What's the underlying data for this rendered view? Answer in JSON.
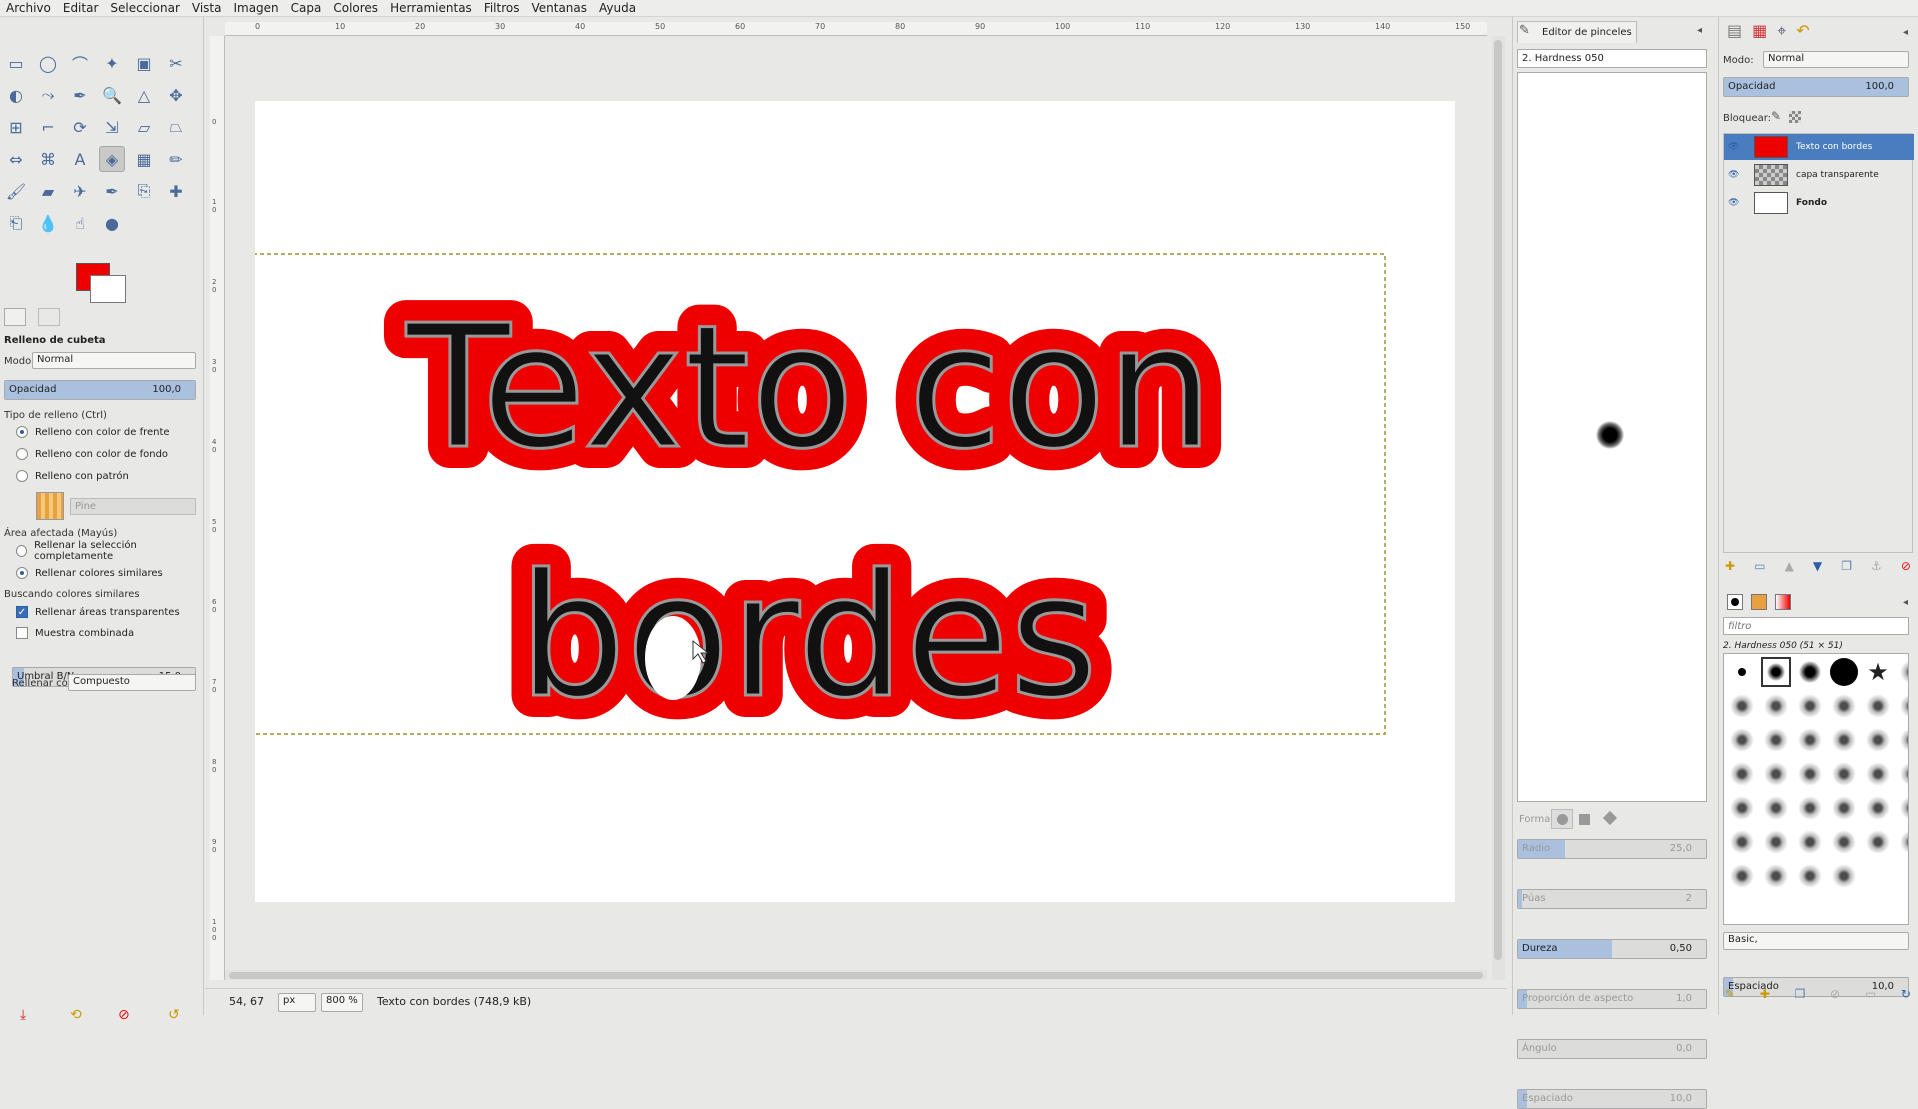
{
  "menu": [
    "Archivo",
    "Editar",
    "Seleccionar",
    "Vista",
    "Imagen",
    "Capa",
    "Colores",
    "Herramientas",
    "Filtros",
    "Ventanas",
    "Ayuda"
  ],
  "ruler_top": [
    "0",
    "10",
    "20",
    "30",
    "40",
    "50",
    "60",
    "70",
    "80",
    "90",
    "100",
    "110",
    "120",
    "130",
    "140",
    "150"
  ],
  "ruler_left": [
    "0",
    "1\n0",
    "2\n0",
    "3\n0",
    "4\n0",
    "5\n0",
    "6\n0",
    "7\n0",
    "8\n0",
    "9\n0",
    "1\n0\n0"
  ],
  "tool_options": {
    "title": "Relleno de cubeta",
    "mode_label": "Modo:",
    "mode_value": "Normal",
    "opacity_label": "Opacidad",
    "opacity_value": "100,0",
    "fill_type_label": "Tipo de relleno  (Ctrl)",
    "fill_fg": "Relleno con color de frente",
    "fill_bg": "Relleno con color de fondo",
    "fill_pattern": "Relleno con patrón",
    "pattern_name": "Pine",
    "affected_label": "Área afectada  (Mayús)",
    "affect_selection": "Rellenar la selección completamente",
    "affect_similar": "Rellenar colores similares",
    "similar_label": "Buscando colores similares",
    "fill_transparent": "Rellenar áreas transparentes",
    "sample_merged": "Muestra combinada",
    "threshold_label": "Umbral B/N",
    "threshold_value": "15,0",
    "fill_with_label": "Rellenar con:",
    "fill_with_value": "Compuesto"
  },
  "colors": {
    "foreground": "#ee0000",
    "background": "#ffffff",
    "accent": "#a9c1df"
  },
  "canvas": {
    "line1": "Texto con",
    "line2": "bordes"
  },
  "status": {
    "coords": "54, 67",
    "unit": "px",
    "zoom": "800 %",
    "layer_info": "Texto con bordes (748,9 kB)"
  },
  "brush_editor": {
    "tab_title": "Editor de pinceles",
    "brush_name": "2. Hardness 050",
    "shape_label": "Forma:",
    "params": [
      {
        "label": "Radio",
        "value": "25,0",
        "fill": 0.25
      },
      {
        "label": "Púas",
        "value": "2",
        "fill": 0.02
      },
      {
        "label": "Dureza",
        "value": "0,50",
        "fill": 0.5
      },
      {
        "label": "Proporción de aspecto",
        "value": "1,0",
        "fill": 0.05
      },
      {
        "label": "Ángulo",
        "value": "0,0",
        "fill": 0.0
      },
      {
        "label": "Espaciado",
        "value": "10,0",
        "fill": 0.05
      }
    ]
  },
  "layers": {
    "mode_label": "Modo:",
    "mode_value": "Normal",
    "opacity_label": "Opacidad",
    "opacity_value": "100,0",
    "lock_label": "Bloquear:",
    "items": [
      {
        "name": "Texto con bordes",
        "selected": true
      },
      {
        "name": "capa transparente",
        "selected": false
      },
      {
        "name": "Fondo",
        "selected": false
      }
    ]
  },
  "brushes": {
    "filter_placeholder": "filtro",
    "current": "2. Hardness 050 (51 × 51)",
    "tag": "Basic,",
    "spacing_label": "Espaciado",
    "spacing_value": "10,0"
  }
}
